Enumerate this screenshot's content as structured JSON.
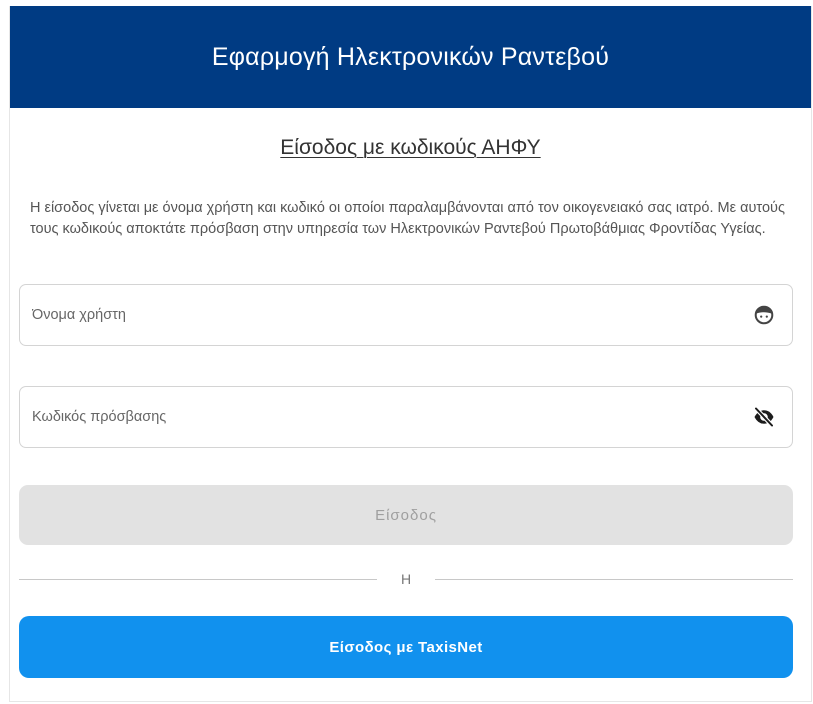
{
  "header": {
    "title": "Εφαρμογή Ηλεκτρονικών Ραντεβού",
    "background_color": "#003b83"
  },
  "login_section": {
    "title": "Είσοδος με κωδικούς ΑΗΦΥ",
    "description": "Η είσοδος γίνεται με όνομα χρήστη και κωδικό οι οποίοι παραλαμβάνονται από τον οικογενειακό σας ιατρό. Με αυτούς τους κωδικούς αποκτάτε πρόσβαση στην υπηρεσία των Ηλεκτρονικών Ραντεβού Πρωτοβάθμιας Φροντίδας Υγείας."
  },
  "username_field": {
    "placeholder": "Όνομα χρήστη",
    "value": "",
    "icon": "user-face-icon"
  },
  "password_field": {
    "placeholder": "Κωδικός πρόσβασης",
    "value": "",
    "icon": "eye-off-icon"
  },
  "login_button": {
    "label": "Είσοδος",
    "state": "disabled",
    "background_color": "#e2e2e2"
  },
  "divider": {
    "label": "Η"
  },
  "taxisnet_button": {
    "label": "Είσοδος με TaxisNet",
    "background_color": "#1191ee"
  }
}
